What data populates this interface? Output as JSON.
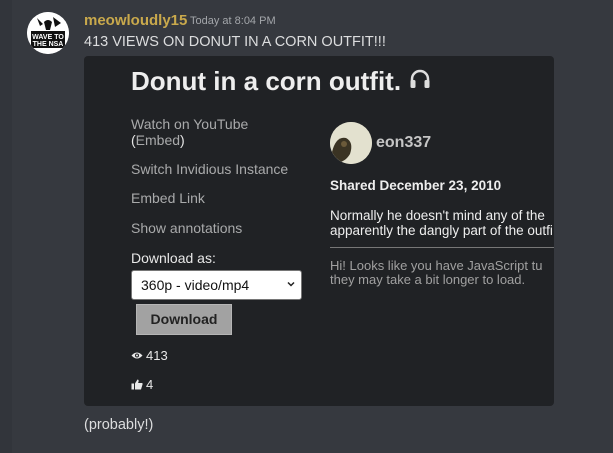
{
  "message": {
    "username": "meowloudly15",
    "timestamp": "Today at 8:04 PM",
    "text": "413 VIEWS ON DONUT IN A CORN OUTFIT!!!",
    "avatar_text_top": "WAVE TO",
    "avatar_text_bottom": "THE NSA",
    "followup": "(probably!)"
  },
  "embed": {
    "title": "Donut in a corn outfit.",
    "title_icon": "headphones-icon",
    "watch_link_line1": "Watch on YouTube",
    "watch_link_line2": "Embed",
    "switch_instance": "Switch Invidious Instance",
    "embed_link": "Embed Link",
    "show_annotations": "Show annotations",
    "download_label": "Download as:",
    "download_selected": "360p - video/mp4",
    "download_button": "Download",
    "views": "413",
    "likes": "4",
    "channel_name": "eon337",
    "shared_date": "Shared December 23, 2010",
    "description_line1": "Normally he doesn't mind any of the",
    "description_line2": "apparently the dangly part of the outfi",
    "notice_line1": "Hi! Looks like you have JavaScript tu",
    "notice_line2": "they may take a bit longer to load."
  },
  "colors": {
    "background": "#36393f",
    "username": "#c9a94c",
    "embed_bg": "#202225"
  }
}
